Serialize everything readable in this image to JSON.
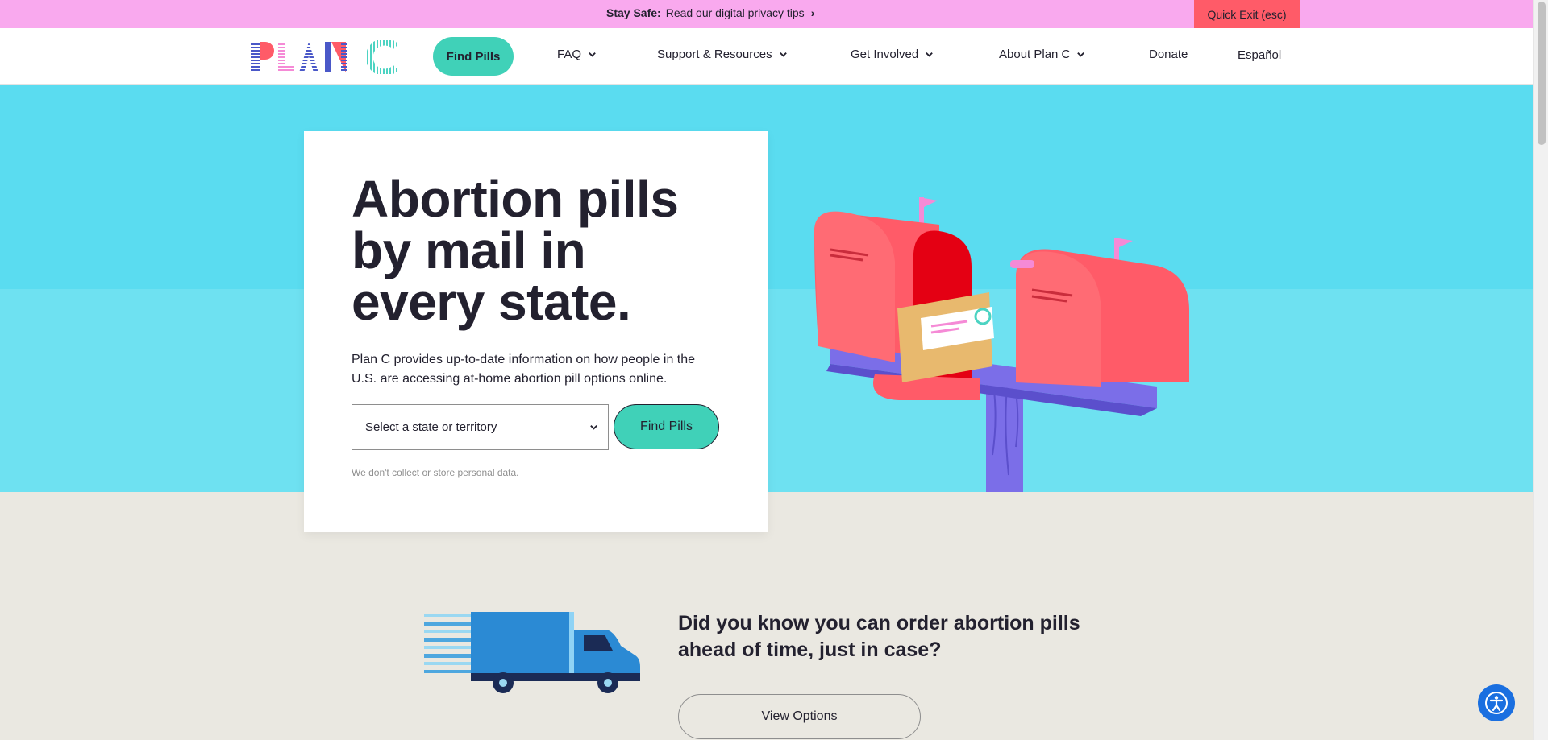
{
  "banner": {
    "prefix": "Stay Safe:",
    "text": "Read our digital privacy tips",
    "quick_exit": "Quick Exit (esc)",
    "background": "#f9a9ee",
    "quick_exit_color": "#ff5b68"
  },
  "header": {
    "logo_text": "PLAN C",
    "find_pills": "Find Pills",
    "nav": {
      "faq": "FAQ",
      "support": "Support & Resources",
      "get_involved": "Get Involved",
      "about": "About Plan C",
      "donate": "Donate",
      "language": "Español"
    }
  },
  "hero": {
    "title": "Abortion pills by mail in every state.",
    "subtitle": "Plan C provides up-to-date information on how people in the U.S. are accessing at-home abortion pill options online.",
    "select_placeholder": "Select a state or territory",
    "find_button": "Find Pills",
    "privacy_note": "We don't collect or store personal data.",
    "accent": "#40d1b8",
    "sky": "#5adcf0"
  },
  "promo": {
    "heading": "Did you know you can order abortion pills ahead of time, just in case?",
    "button": "View Options"
  },
  "icons": {
    "banner_chevron": "chevron-right-icon",
    "nav_chevron": "chevron-down-icon",
    "select_chevron": "chevron-down-icon",
    "accessibility": "accessibility-icon"
  }
}
